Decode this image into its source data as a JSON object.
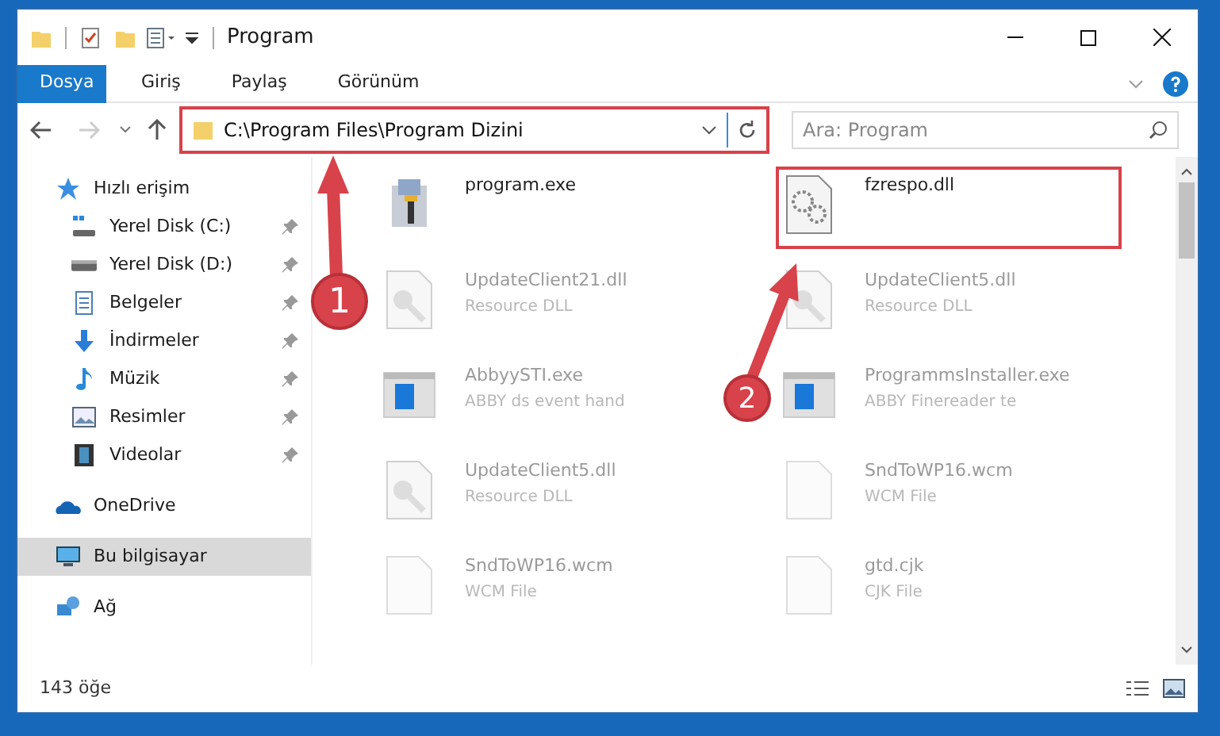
{
  "window": {
    "title": "Program"
  },
  "ribbon": {
    "tabs": [
      {
        "label": "Dosya",
        "selected": true
      },
      {
        "label": "Giriş",
        "selected": false
      },
      {
        "label": "Paylaş",
        "selected": false
      },
      {
        "label": "Görünüm",
        "selected": false
      }
    ]
  },
  "address_bar": {
    "path": "C:\\Program Files\\Program Dizini",
    "highlighted": true
  },
  "search": {
    "placeholder": "Ara: Program"
  },
  "sidebar": {
    "items": [
      {
        "label": "Hızlı erişim",
        "kind": "star",
        "selected": false,
        "children": [
          {
            "label": "Yerel Disk (C:)",
            "kind": "drive-win",
            "pinned": true,
            "selected": false
          },
          {
            "label": "Yerel Disk (D:)",
            "kind": "drive",
            "pinned": true,
            "selected": false
          },
          {
            "label": "Belgeler",
            "kind": "docs",
            "pinned": true,
            "selected": false
          },
          {
            "label": "İndirmeler",
            "kind": "download",
            "pinned": true,
            "selected": false
          },
          {
            "label": "Müzik",
            "kind": "music",
            "pinned": true,
            "selected": false
          },
          {
            "label": "Resimler",
            "kind": "pictures",
            "pinned": true,
            "selected": false
          },
          {
            "label": "Videolar",
            "kind": "video",
            "pinned": true,
            "selected": false
          }
        ]
      },
      {
        "label": "OneDrive",
        "kind": "cloud",
        "selected": false
      },
      {
        "label": "Bu bilgisayar",
        "kind": "computer",
        "selected": true
      },
      {
        "label": "Ağ",
        "kind": "network",
        "selected": false
      }
    ]
  },
  "files": [
    {
      "name": "program.exe",
      "kind": "installer",
      "highlighted": false
    },
    {
      "name": "fzrespo.dll",
      "kind": "gears",
      "highlighted": true
    },
    {
      "name": "UpdateClient21.dll",
      "type": "Resource DLL",
      "kind": "dll",
      "highlighted": false
    },
    {
      "name": "UpdateClient5.dll",
      "type": "Resource DLL",
      "kind": "dll",
      "highlighted": false
    },
    {
      "name": "AbbyySTI.exe",
      "type": "ABBY ds event hand",
      "kind": "app",
      "highlighted": false
    },
    {
      "name": "ProgrammsInstaller.exe",
      "type": "ABBY Finereader te",
      "kind": "app",
      "highlighted": false
    },
    {
      "name": "UpdateClient5.dll",
      "type": "Resource DLL",
      "kind": "dll",
      "highlighted": false
    },
    {
      "name": "SndToWP16.wcm",
      "type": "WCM File",
      "kind": "blank",
      "highlighted": false
    },
    {
      "name": "SndToWP16.wcm",
      "type": "WCM File",
      "kind": "blank",
      "highlighted": false
    },
    {
      "name": "gtd.cjk",
      "type": "CJK File",
      "kind": "blank",
      "highlighted": false
    }
  ],
  "callouts": [
    {
      "number": "1"
    },
    {
      "number": "2"
    }
  ],
  "status_bar": {
    "count": "143 öğe"
  }
}
